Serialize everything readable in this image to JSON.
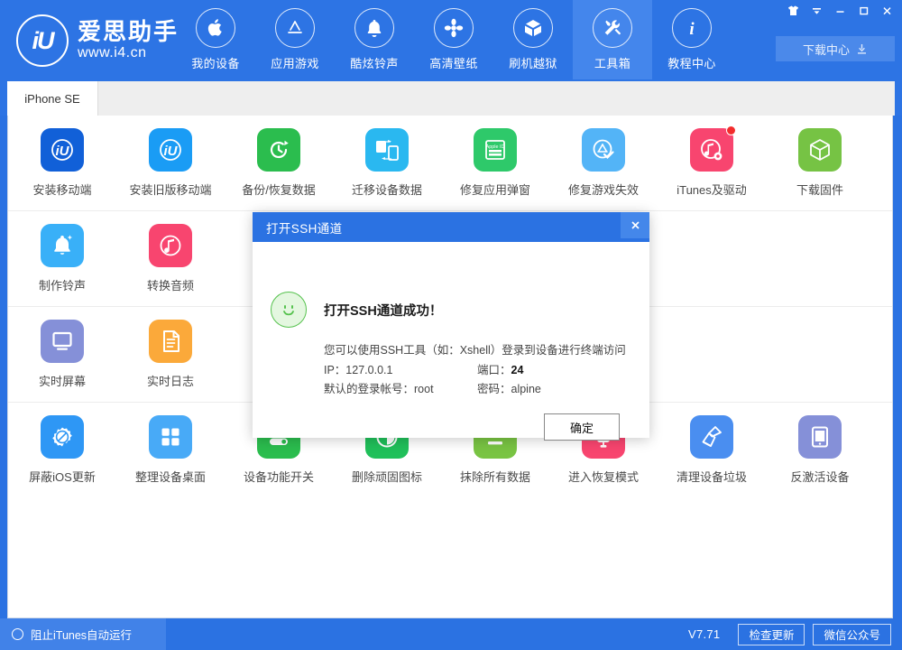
{
  "app": {
    "brand_cn": "爱思助手",
    "brand_url": "www.i4.cn",
    "logo_glyph": "iU",
    "accent": "#2b72e2",
    "accent_light": "#4486ec"
  },
  "header": {
    "nav": [
      {
        "label": "我的设备",
        "icon": "apple-icon",
        "active": false
      },
      {
        "label": "应用游戏",
        "icon": "appstore-icon",
        "active": false
      },
      {
        "label": "酷炫铃声",
        "icon": "bell-icon",
        "active": false
      },
      {
        "label": "高清壁纸",
        "icon": "flower-icon",
        "active": false
      },
      {
        "label": "刷机越狱",
        "icon": "box-icon",
        "active": false
      },
      {
        "label": "工具箱",
        "icon": "tools-icon",
        "active": true
      },
      {
        "label": "教程中心",
        "icon": "info-icon",
        "active": false
      }
    ],
    "window_controls": [
      {
        "name": "skin-icon",
        "title": "皮肤"
      },
      {
        "name": "menu-icon",
        "title": "菜单"
      },
      {
        "name": "minimize-icon",
        "title": "最小化"
      },
      {
        "name": "maximize-icon",
        "title": "最大化"
      },
      {
        "name": "close-icon",
        "title": "关闭"
      }
    ],
    "download_center": "下载中心"
  },
  "device_tabs": [
    {
      "label": "iPhone SE",
      "active": true
    }
  ],
  "toolbox": {
    "rows": [
      [
        {
          "label": "安装移动端",
          "icon": "i4-app-icon",
          "color": "#1160d8",
          "badge": false
        },
        {
          "label": "安装旧版移动端",
          "icon": "i4-app-old-icon",
          "color": "#1a9cf5",
          "badge": false
        },
        {
          "label": "备份/恢复数据",
          "icon": "backup-restore-icon",
          "color": "#2bbd4e",
          "badge": false
        },
        {
          "label": "迁移设备数据",
          "icon": "migrate-data-icon",
          "color": "#2ab8f0",
          "badge": false
        },
        {
          "label": "修复应用弹窗",
          "icon": "appleid-fix-icon",
          "color": "#2ec96a",
          "badge": false
        },
        {
          "label": "修复游戏失效",
          "icon": "appstore-fix-icon",
          "color": "#53b4f7",
          "badge": false
        },
        {
          "label": "iTunes及驱动",
          "icon": "itunes-driver-icon",
          "color": "#f8456f",
          "badge": true
        },
        {
          "label": "下载固件",
          "icon": "firmware-icon",
          "color": "#76c344",
          "badge": false
        }
      ],
      [
        {
          "label": "制作铃声",
          "icon": "ringtone-maker-icon",
          "color": "#39b0f8",
          "badge": false
        },
        {
          "label": "转换音频",
          "icon": "audio-convert-icon",
          "color": "#f8456f",
          "badge": false
        }
      ],
      [
        {
          "label": "实时屏幕",
          "icon": "live-screen-icon",
          "color": "#8590d8",
          "badge": false
        },
        {
          "label": "实时日志",
          "icon": "live-log-icon",
          "color": "#fba93a",
          "badge": false
        }
      ],
      [
        {
          "label": "屏蔽iOS更新",
          "icon": "block-ios-update-icon",
          "color": "#2e97f5",
          "badge": false
        },
        {
          "label": "整理设备桌面",
          "icon": "organize-desktop-icon",
          "color": "#48aaf7",
          "badge": false
        },
        {
          "label": "设备功能开关",
          "icon": "device-switch-icon",
          "color": "#2bbd4e",
          "badge": false
        },
        {
          "label": "删除顽固图标",
          "icon": "remove-icon-icon",
          "color": "#20c05a",
          "badge": false
        },
        {
          "label": "抹除所有数据",
          "icon": "erase-data-icon",
          "color": "#79c443",
          "badge": false
        },
        {
          "label": "进入恢复模式",
          "icon": "recovery-mode-icon",
          "color": "#f8456f",
          "badge": false
        },
        {
          "label": "清理设备垃圾",
          "icon": "clean-junk-icon",
          "color": "#4a8ef0",
          "badge": false
        },
        {
          "label": "反激活设备",
          "icon": "deactivate-icon",
          "color": "#8590d8",
          "badge": false
        }
      ]
    ]
  },
  "footer": {
    "block_itunes": "阻止iTunes自动运行",
    "version": "V7.71",
    "check_update": "检查更新",
    "wechat": "微信公众号"
  },
  "dialog": {
    "title": "打开SSH通道",
    "heading": "打开SSH通道成功！",
    "description": "您可以使用SSH工具（如：Xshell）登录到设备进行终端访问",
    "ip_label": "IP：127.0.0.1",
    "port_label": "端口：",
    "port_value": "24",
    "account_label": "默认的登录帐号：root",
    "password_label": "密码：alpine",
    "ok": "确定",
    "close": "×"
  }
}
